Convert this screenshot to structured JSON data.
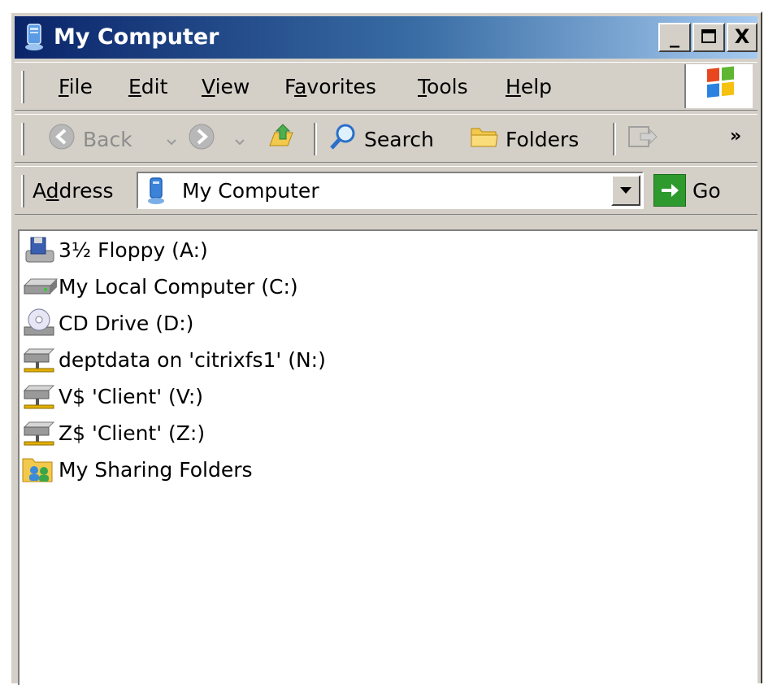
{
  "window": {
    "title": "My Computer",
    "icon": "my-computer-icon"
  },
  "caption_buttons": {
    "minimize": "_",
    "maximize": "□",
    "close": "X"
  },
  "menu": {
    "items": [
      {
        "label": "File",
        "accel": "F",
        "rest": "ile"
      },
      {
        "label": "Edit",
        "accel": "E",
        "rest": "dit"
      },
      {
        "label": "View",
        "accel": "V",
        "rest": "iew"
      },
      {
        "label": "Favorites",
        "pre": "F",
        "accel": "a",
        "rest": "vorites"
      },
      {
        "label": "Tools",
        "accel": "T",
        "rest": "ools"
      },
      {
        "label": "Help",
        "accel": "H",
        "rest": "elp"
      }
    ]
  },
  "toolbar": {
    "back_label": "Back",
    "search_label": "Search",
    "folders_label": "Folders",
    "overflow": "»"
  },
  "address": {
    "label_pre": "A",
    "label_accel": "d",
    "label_rest": "dress",
    "value": "My Computer",
    "go_label": "Go"
  },
  "drives": [
    {
      "label": "3½ Floppy (A:)",
      "icon": "floppy-drive-icon"
    },
    {
      "label": "My Local Computer (C:)",
      "icon": "hard-drive-icon"
    },
    {
      "label": "CD Drive (D:)",
      "icon": "cd-drive-icon"
    },
    {
      "label": "deptdata on 'citrixfs1' (N:)",
      "icon": "network-drive-icon"
    },
    {
      "label": "V$ 'Client' (V:)",
      "icon": "network-drive-icon"
    },
    {
      "label": "Z$ 'Client' (Z:)",
      "icon": "network-drive-icon"
    },
    {
      "label": "My Sharing Folders",
      "icon": "shared-folder-icon"
    }
  ],
  "colors": {
    "title_gradient_start": "#0a246a",
    "title_gradient_end": "#a6caf0",
    "chrome": "#d4d0c8",
    "go_green": "#2e9a2e"
  }
}
